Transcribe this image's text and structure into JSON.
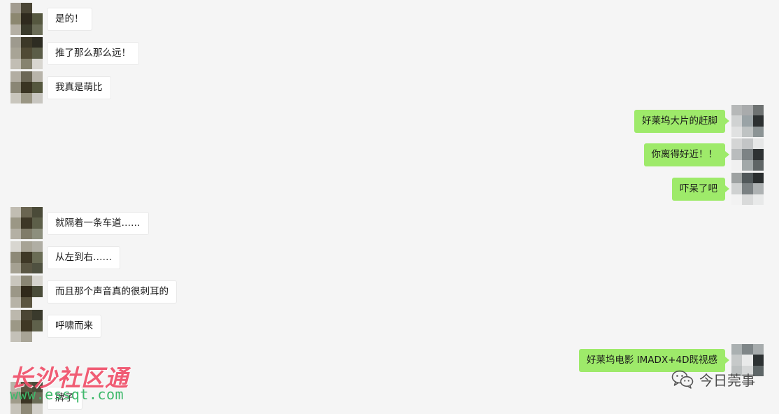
{
  "messages": [
    {
      "side": "left",
      "text": "是的！"
    },
    {
      "side": "left",
      "text": "推了那么那么远！"
    },
    {
      "side": "left",
      "text": "我真是萌比"
    },
    {
      "side": "right",
      "text": "好莱坞大片的赶脚"
    },
    {
      "side": "right",
      "text": "你离得好近！！"
    },
    {
      "side": "right",
      "text": "吓呆了吧"
    },
    {
      "side": "left",
      "text": "就隔着一条车道……"
    },
    {
      "side": "left",
      "text": "从左到右……"
    },
    {
      "side": "left",
      "text": "而且那个声音真的很刺耳的"
    },
    {
      "side": "left",
      "text": "呼啸而来"
    },
    {
      "side": "right",
      "text": "好莱坞电影 IMADX+4D既视感"
    },
    {
      "side": "left",
      "text": "牌子"
    }
  ],
  "watermark": {
    "site_name": "长沙社区通",
    "site_url": "www.essqt.com"
  },
  "brand": {
    "account_name": "今日莞事",
    "icon": "wechat-icon"
  },
  "colors": {
    "background": "#f5f5f5",
    "own_bubble": "#9eea6a",
    "other_bubble": "#ffffff"
  }
}
